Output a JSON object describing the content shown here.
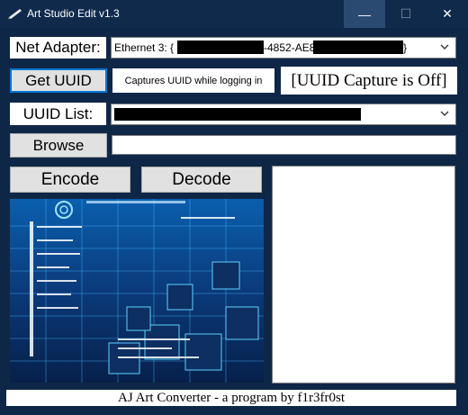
{
  "window": {
    "title": "Art Studio Edit v1.3",
    "controls": {
      "minimize": "—",
      "maximize": "☐",
      "close": "✕"
    }
  },
  "net_adapter": {
    "label": "Net Adapter:",
    "value_prefix": "Ethernet 3: {",
    "value_middle": "-4852-AE8",
    "value_suffix": "}"
  },
  "uuid": {
    "get_button": "Get UUID",
    "note": "Captures UUID while logging in",
    "capture_status": "[UUID Capture is Off]"
  },
  "uuid_list": {
    "label": "UUID List:"
  },
  "browse": {
    "button": "Browse",
    "path_value": ""
  },
  "actions": {
    "encode": "Encode",
    "decode": "Decode"
  },
  "output": {
    "text": ""
  },
  "footer": {
    "text": "AJ Art Converter - a program by f1r3fr0st"
  },
  "colors": {
    "window_bg": "#0f2747",
    "titlebar": "#102a4c",
    "accent_focus": "#0078d7",
    "button_bg": "#e1e1e1"
  },
  "icons": {
    "app": "pencil-icon",
    "dropdown": "chevron-down-icon"
  }
}
